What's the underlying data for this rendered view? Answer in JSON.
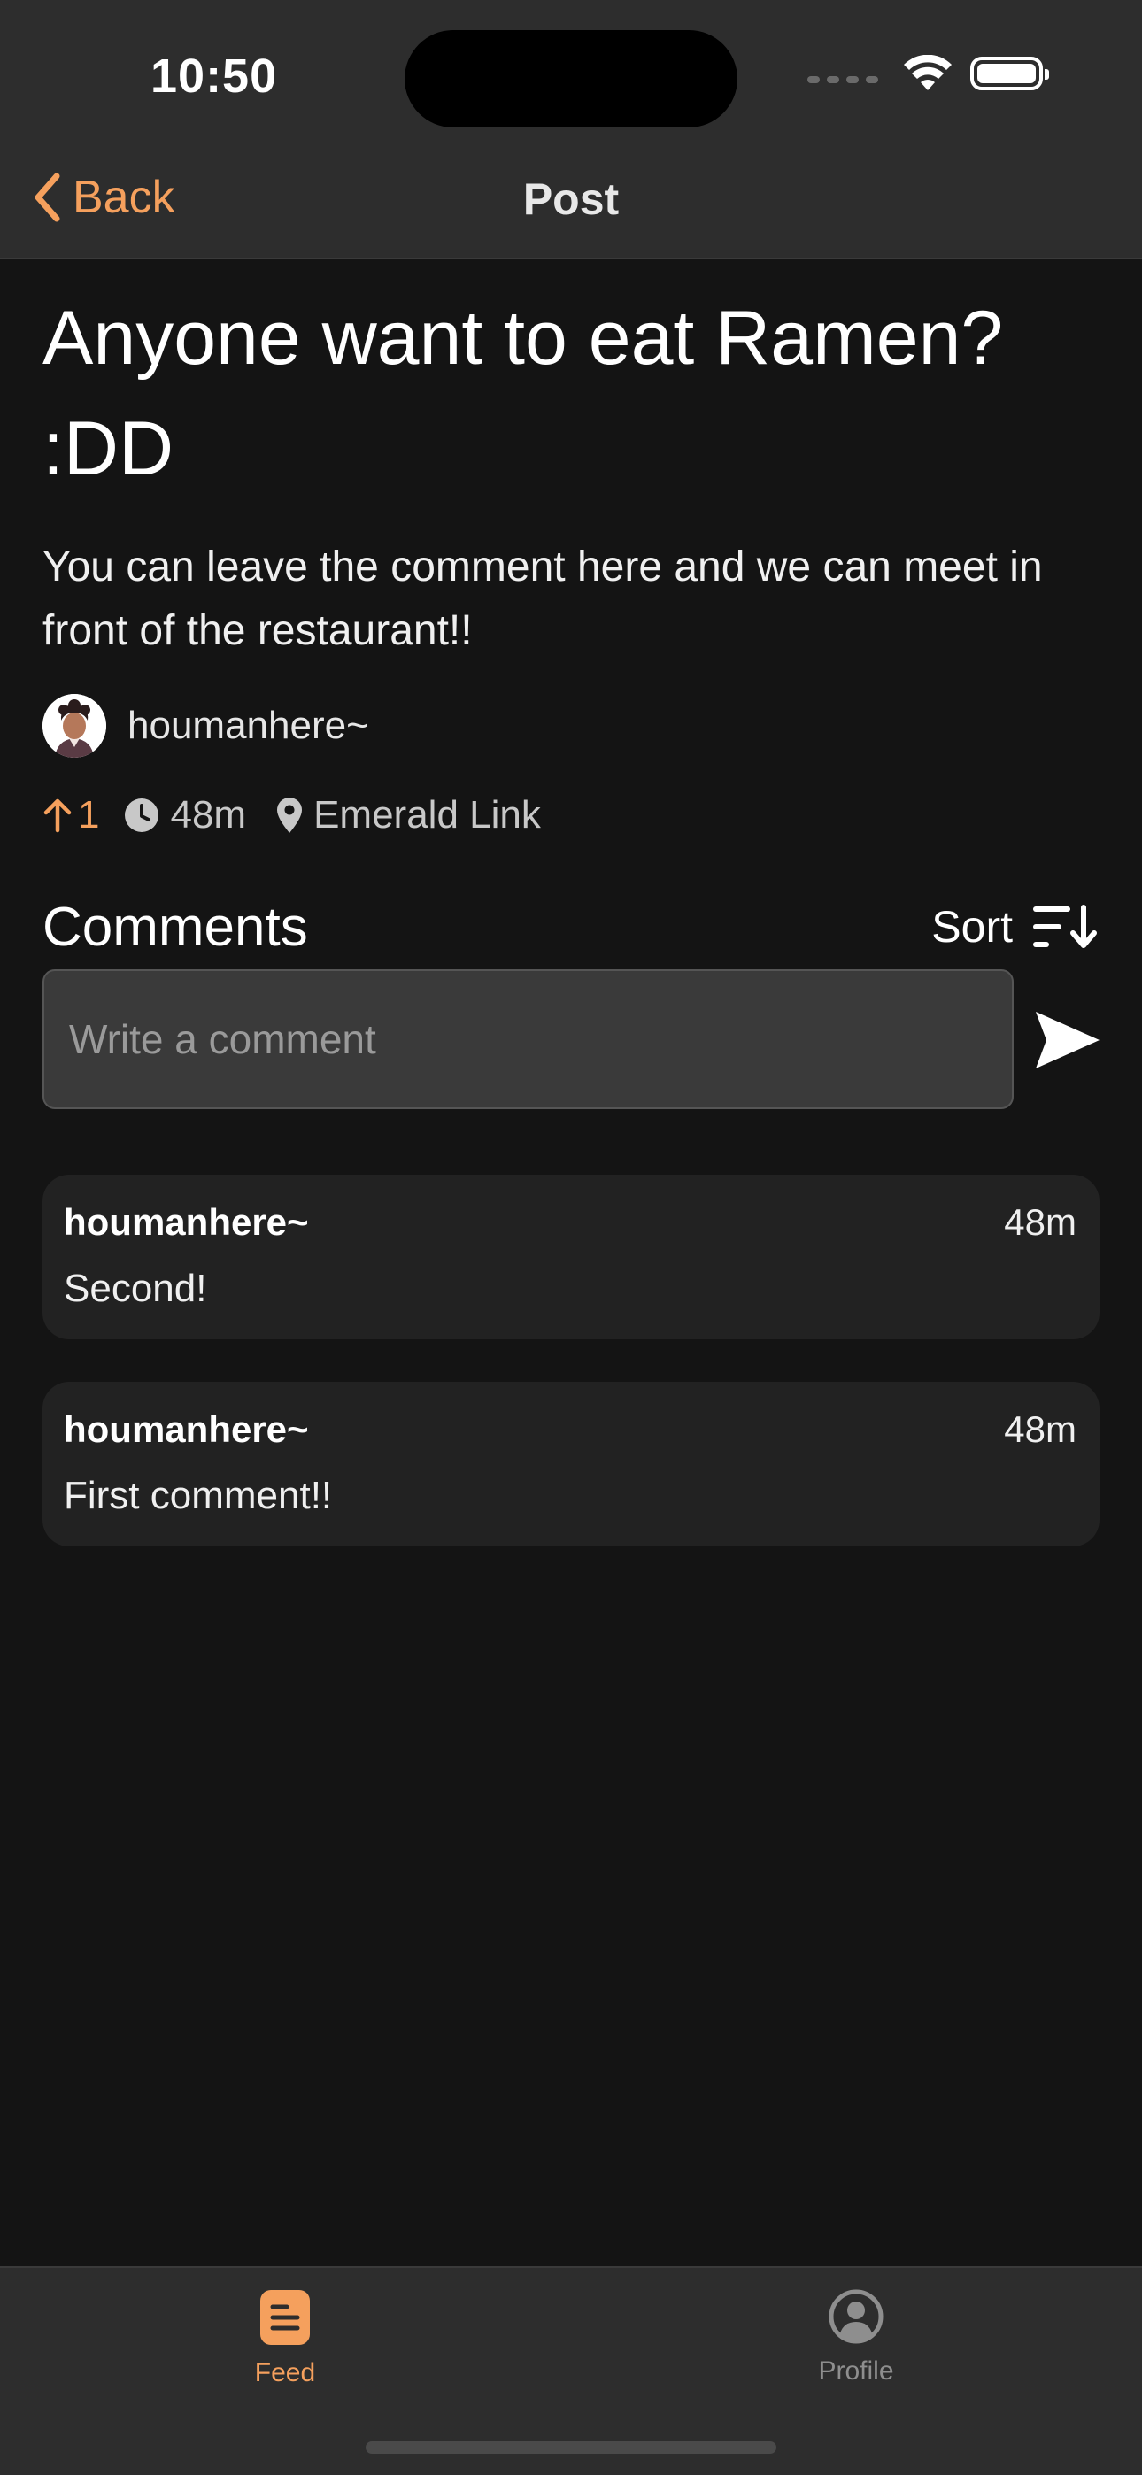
{
  "status_bar": {
    "time": "10:50"
  },
  "nav": {
    "back_label": "Back",
    "title": "Post"
  },
  "post": {
    "title": "Anyone want to eat Ramen? :DD",
    "body": "You can leave the comment here and we can meet in front of the restaurant!!",
    "author": "houmanhere~",
    "upvotes": "1",
    "age": "48m",
    "location": "Emerald Link"
  },
  "comments_section": {
    "heading": "Comments",
    "sort_label": "Sort",
    "input_placeholder": "Write a comment",
    "items": [
      {
        "author": "houmanhere~",
        "time": "48m",
        "text": "Second!"
      },
      {
        "author": "houmanhere~",
        "time": "48m",
        "text": "First comment!!"
      }
    ]
  },
  "tab_bar": {
    "tabs": [
      {
        "label": "Feed",
        "icon": "feed-icon",
        "active": true
      },
      {
        "label": "Profile",
        "icon": "profile-icon",
        "active": false
      }
    ]
  },
  "colors": {
    "accent": "#f5a05d",
    "background": "#141414",
    "bar_background": "#2d2d2d",
    "card_background": "#222222"
  }
}
